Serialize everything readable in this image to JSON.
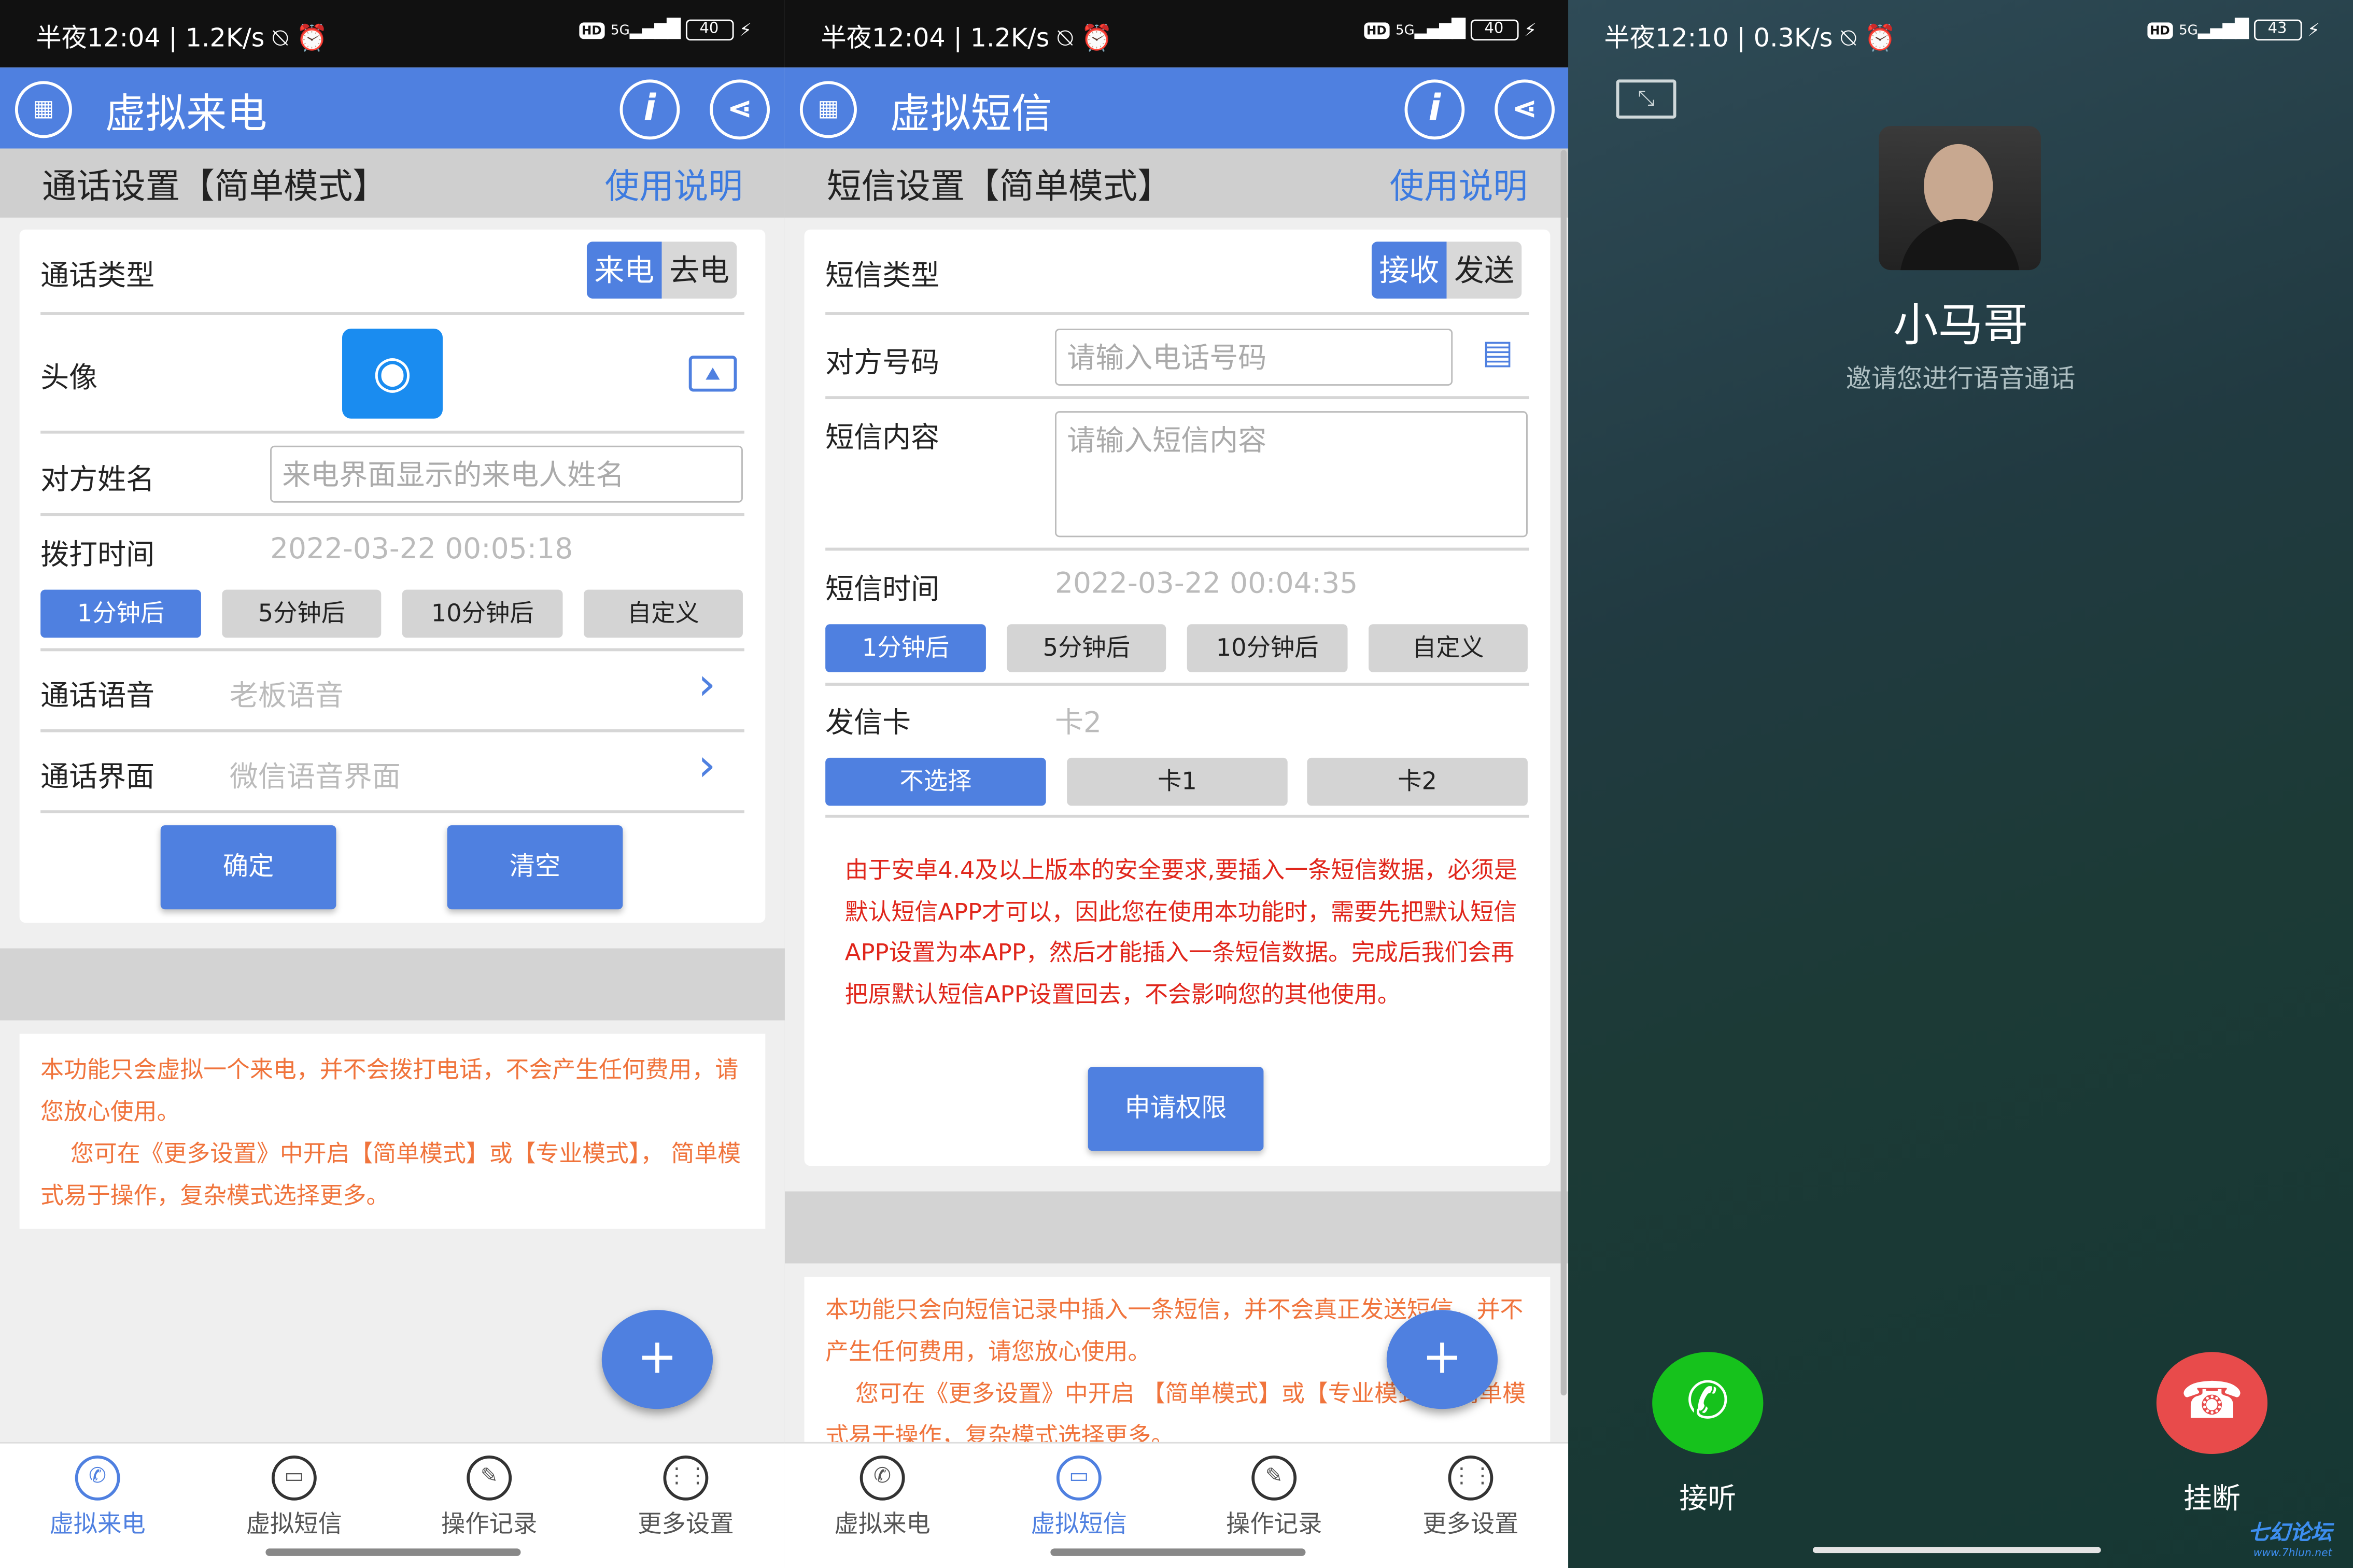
{
  "status": {
    "p1": {
      "time": "半夜12:04 | 1.2K/s ⍉ ⏰",
      "hd": "HD",
      "net": "5G",
      "battery": "40"
    },
    "p2": {
      "time": "半夜12:04 | 1.2K/s ⍉ ⏰",
      "hd": "HD",
      "net": "5G",
      "battery": "40"
    },
    "p3": {
      "time": "半夜12:10 | 0.3K/s ⍉ ⏰",
      "hd": "HD",
      "net": "5G",
      "battery": "43"
    }
  },
  "call_app": {
    "title": "虚拟来电",
    "section_title": "通话设置【简单模式】",
    "help": "使用说明",
    "call_type_label": "通话类型",
    "call_type_options": [
      "来电",
      "去电"
    ],
    "avatar_label": "头像",
    "name_label": "对方姓名",
    "name_placeholder": "来电界面显示的来电人姓名",
    "dial_time_label": "拨打时间",
    "dial_time_value": "2022-03-22 00:05:18",
    "time_options": [
      "1分钟后",
      "5分钟后",
      "10分钟后",
      "自定义"
    ],
    "voice_label": "通话语音",
    "voice_value": "老板语音",
    "ui_label": "通话界面",
    "ui_value": "微信语音界面",
    "confirm": "确定",
    "clear": "清空",
    "note_line1": "本功能只会虚拟一个来电，并不会拨打电话，不会产生任何费用，请您放心使用。",
    "note_line2": "您可在《更多设置》中开启【简单模式】或【专业模式】， 简单模式易于操作，复杂模式选择更多。",
    "fab": "+"
  },
  "sms_app": {
    "title": "虚拟短信",
    "section_title": "短信设置【简单模式】",
    "help": "使用说明",
    "type_label": "短信类型",
    "type_options": [
      "接收",
      "发送"
    ],
    "number_label": "对方号码",
    "number_placeholder": "请输入电话号码",
    "content_label": "短信内容",
    "content_placeholder": "请输入短信内容",
    "time_label": "短信时间",
    "time_value": "2022-03-22 00:04:35",
    "time_options": [
      "1分钟后",
      "5分钟后",
      "10分钟后",
      "自定义"
    ],
    "card_label": "发信卡",
    "card_value": "卡2",
    "card_options": [
      "不选择",
      "卡1",
      "卡2"
    ],
    "warning": "由于安卓4.4及以上版本的安全要求,要插入一条短信数据，必须是默认短信APP才可以，因此您在使用本功能时，需要先把默认短信APP设置为本APP，然后才能插入一条短信数据。完成后我们会再把原默认短信APP设置回去，不会影响您的其他使用。",
    "permission_button": "申请权限",
    "note_line1": "本功能只会向短信记录中插入一条短信，并不会真正发送短信，并不产生任何费用，请您放心使用。",
    "note_line2": "您可在《更多设置》中开启 【简单模式】或【专业模式】，简单模式易于操作，复杂模式选择更多。",
    "fab": "+"
  },
  "tabs": [
    "虚拟来电",
    "虚拟短信",
    "操作记录",
    "更多设置"
  ],
  "incoming": {
    "caller_name": "小马哥",
    "subtitle": "邀请您进行语音通话",
    "answer": "接听",
    "hangup": "挂断",
    "watermark": "七幻论坛",
    "watermark_sub": "www.7hlun.net"
  },
  "colors": {
    "accent": "#4f80e0",
    "warning": "#e0261b",
    "note": "#f0743c",
    "answer": "#16c21c",
    "hangup": "#e84b4b"
  }
}
